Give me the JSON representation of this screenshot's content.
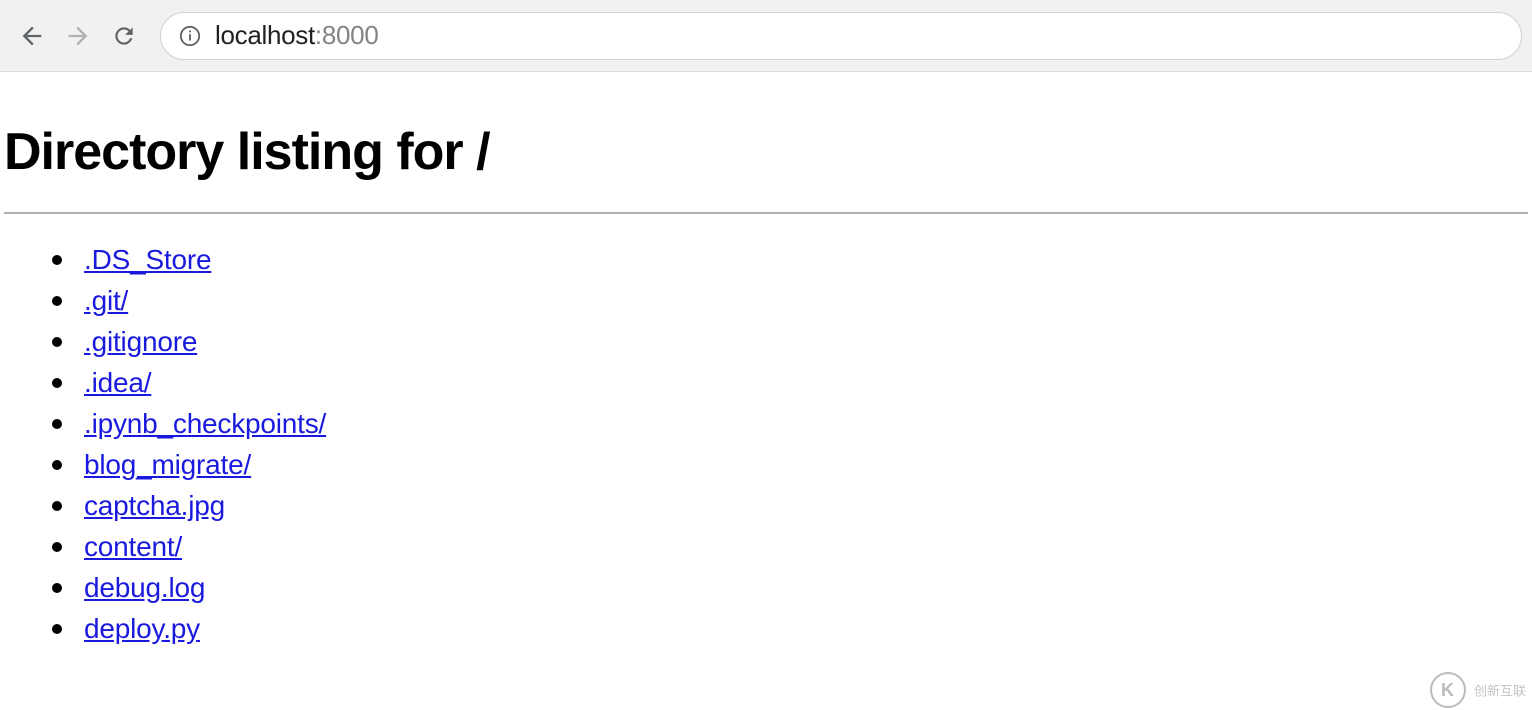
{
  "browser": {
    "url_host": "localhost",
    "url_port": ":8000"
  },
  "page": {
    "title": "Directory listing for /",
    "files": [
      ".DS_Store",
      ".git/",
      ".gitignore",
      ".idea/",
      ".ipynb_checkpoints/",
      "blog_migrate/",
      "captcha.jpg",
      "content/",
      "debug.log",
      "deploy.py"
    ]
  },
  "watermark": {
    "text": "创新互联"
  }
}
